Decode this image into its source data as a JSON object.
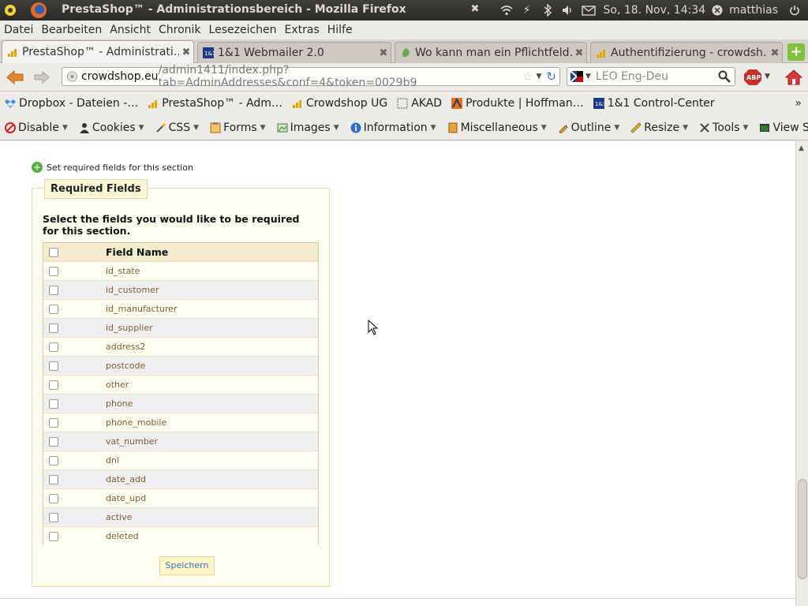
{
  "window": {
    "title": "PrestaShop™ - Administrationsbereich - Mozilla Firefox",
    "datetime": "So, 18. Nov, 14:34",
    "user": "matthias"
  },
  "menu": [
    "Datei",
    "Bearbeiten",
    "Ansicht",
    "Chronik",
    "Lesezeichen",
    "Extras",
    "Hilfe"
  ],
  "tabs": [
    {
      "label": "PrestaShop™ - Administrati…",
      "active": true
    },
    {
      "label": "1&1 Webmailer 2.0",
      "active": false
    },
    {
      "label": "Wo kann man ein Pflichtfeld…",
      "active": false
    },
    {
      "label": "Authentifizierung - crowdsh…",
      "active": false
    }
  ],
  "address": {
    "host": "crowdshop.eu",
    "path": "/admin1411/index.php?tab=AdminAddresses&conf=4&token=0029b9"
  },
  "search": {
    "placeholder": "LEO Eng-Deu"
  },
  "bookmarks": [
    "Dropbox - Dateien -…",
    "PrestaShop™ - Adm…",
    "Crowdshop UG",
    "AKAD",
    "Produkte | Hoffman…",
    "1&1 Control-Center"
  ],
  "devtools": [
    "Disable",
    "Cookies",
    "CSS",
    "Forms",
    "Images",
    "Information",
    "Miscellaneous",
    "Outline",
    "Resize",
    "Tools",
    "View S"
  ],
  "page": {
    "set_required_link": "Set required fields for this section",
    "legend": "Required Fields",
    "instruction": "Select the fields you would like to be required for this section.",
    "column_header": "Field Name",
    "fields": [
      "id_state",
      "id_customer",
      "id_manufacturer",
      "id_supplier",
      "address2",
      "postcode",
      "other",
      "phone",
      "phone_mobile",
      "vat_number",
      "dni",
      "date_add",
      "date_upd",
      "active",
      "deleted"
    ],
    "save_label": "Speichern"
  },
  "colors": {
    "panel_bg": "#fffff0",
    "legend_bg": "#fff6d3",
    "field_text": "#7f5a3a",
    "save_text": "#2f79c0"
  }
}
